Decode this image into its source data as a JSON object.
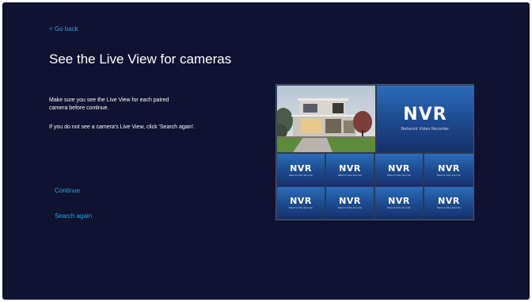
{
  "nav": {
    "back_label": "< Go back"
  },
  "page": {
    "title": "See the Live View for cameras"
  },
  "instructions": {
    "line1": "Make sure you see the Live View for each paired camera before continue.",
    "line2": "If you do not see a camera's Live View, click 'Search again'."
  },
  "actions": {
    "continue_label": "Continue",
    "search_again_label": "Search again"
  },
  "preview": {
    "logo_text": "NVR",
    "logo_subtitle": "Network Video Recorder",
    "tiles_small": [
      {
        "logo": "NVR",
        "sub": "Network Video Recorder"
      },
      {
        "logo": "NVR",
        "sub": "Network Video Recorder"
      },
      {
        "logo": "NVR",
        "sub": "Network Video Recorder"
      },
      {
        "logo": "NVR",
        "sub": "Network Video Recorder"
      },
      {
        "logo": "NVR",
        "sub": "Network Video Recorder"
      },
      {
        "logo": "NVR",
        "sub": "Network Video Recorder"
      },
      {
        "logo": "NVR",
        "sub": "Network Video Recorder"
      },
      {
        "logo": "NVR",
        "sub": "Network Video Recorder"
      }
    ]
  },
  "colors": {
    "background": "#0f1230",
    "link": "#29a8e0",
    "text": "#ffffff",
    "tile_top": "#2c6cb8",
    "tile_bottom": "#15306a"
  }
}
